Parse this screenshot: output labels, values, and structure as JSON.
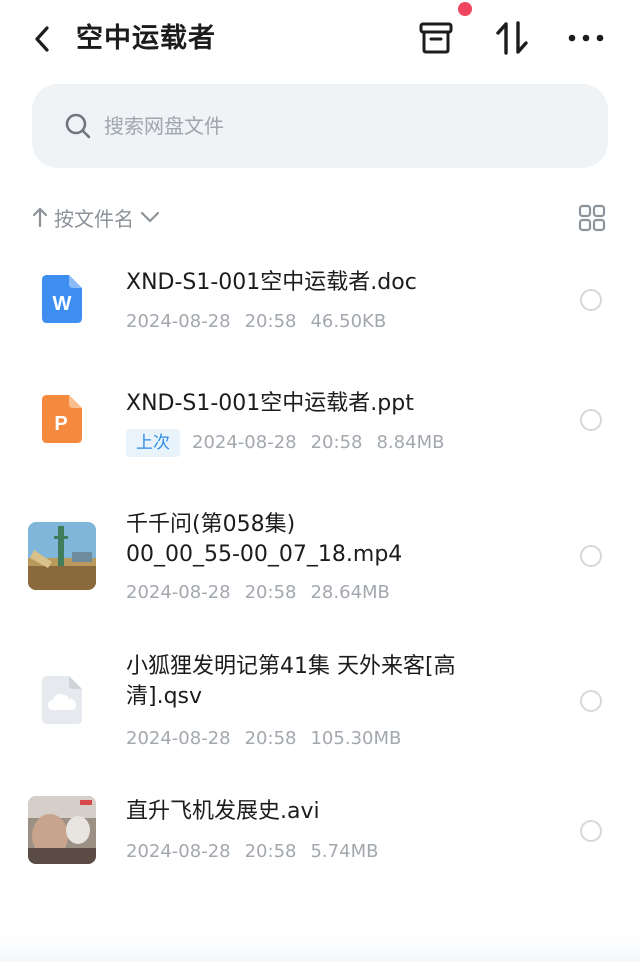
{
  "header": {
    "title": "空中运载者"
  },
  "search": {
    "placeholder": "搜索网盘文件"
  },
  "sortbar": {
    "label": "按文件名"
  },
  "files": [
    {
      "name_line1": "XND-S1-001空中运载者.doc",
      "name_line2": "",
      "type": "doc",
      "icon": "word-doc-icon",
      "tag": "",
      "date": "2024-08-28",
      "time": "20:58",
      "size": "46.50KB"
    },
    {
      "name_line1": "XND-S1-001空中运载者.ppt",
      "name_line2": "",
      "type": "ppt",
      "icon": "powerpoint-icon",
      "tag": "上次",
      "date": "2024-08-28",
      "time": "20:58",
      "size": "8.84MB"
    },
    {
      "name_line1": "千千问(第058集)",
      "name_line2": "00_00_55-00_07_18.mp4",
      "type": "video",
      "icon": "video-thumbnail",
      "tag": "",
      "date": "2024-08-28",
      "time": "20:58",
      "size": "28.64MB"
    },
    {
      "name_line1": "小狐狸发明记第41集 天外来客[高",
      "name_line2": "清].qsv",
      "type": "unknown",
      "icon": "cloud-file-icon",
      "tag": "",
      "date": "2024-08-28",
      "time": "20:58",
      "size": "105.30MB"
    },
    {
      "name_line1": "直升飞机发展史.avi",
      "name_line2": "",
      "type": "video",
      "icon": "video-thumbnail",
      "tag": "",
      "date": "2024-08-28",
      "time": "20:58",
      "size": "5.74MB"
    }
  ],
  "colors": {
    "accent": "#2e8ce6",
    "notification_dot": "#f0455f",
    "word": "#3d8ef0",
    "powerpoint": "#f5893d"
  }
}
